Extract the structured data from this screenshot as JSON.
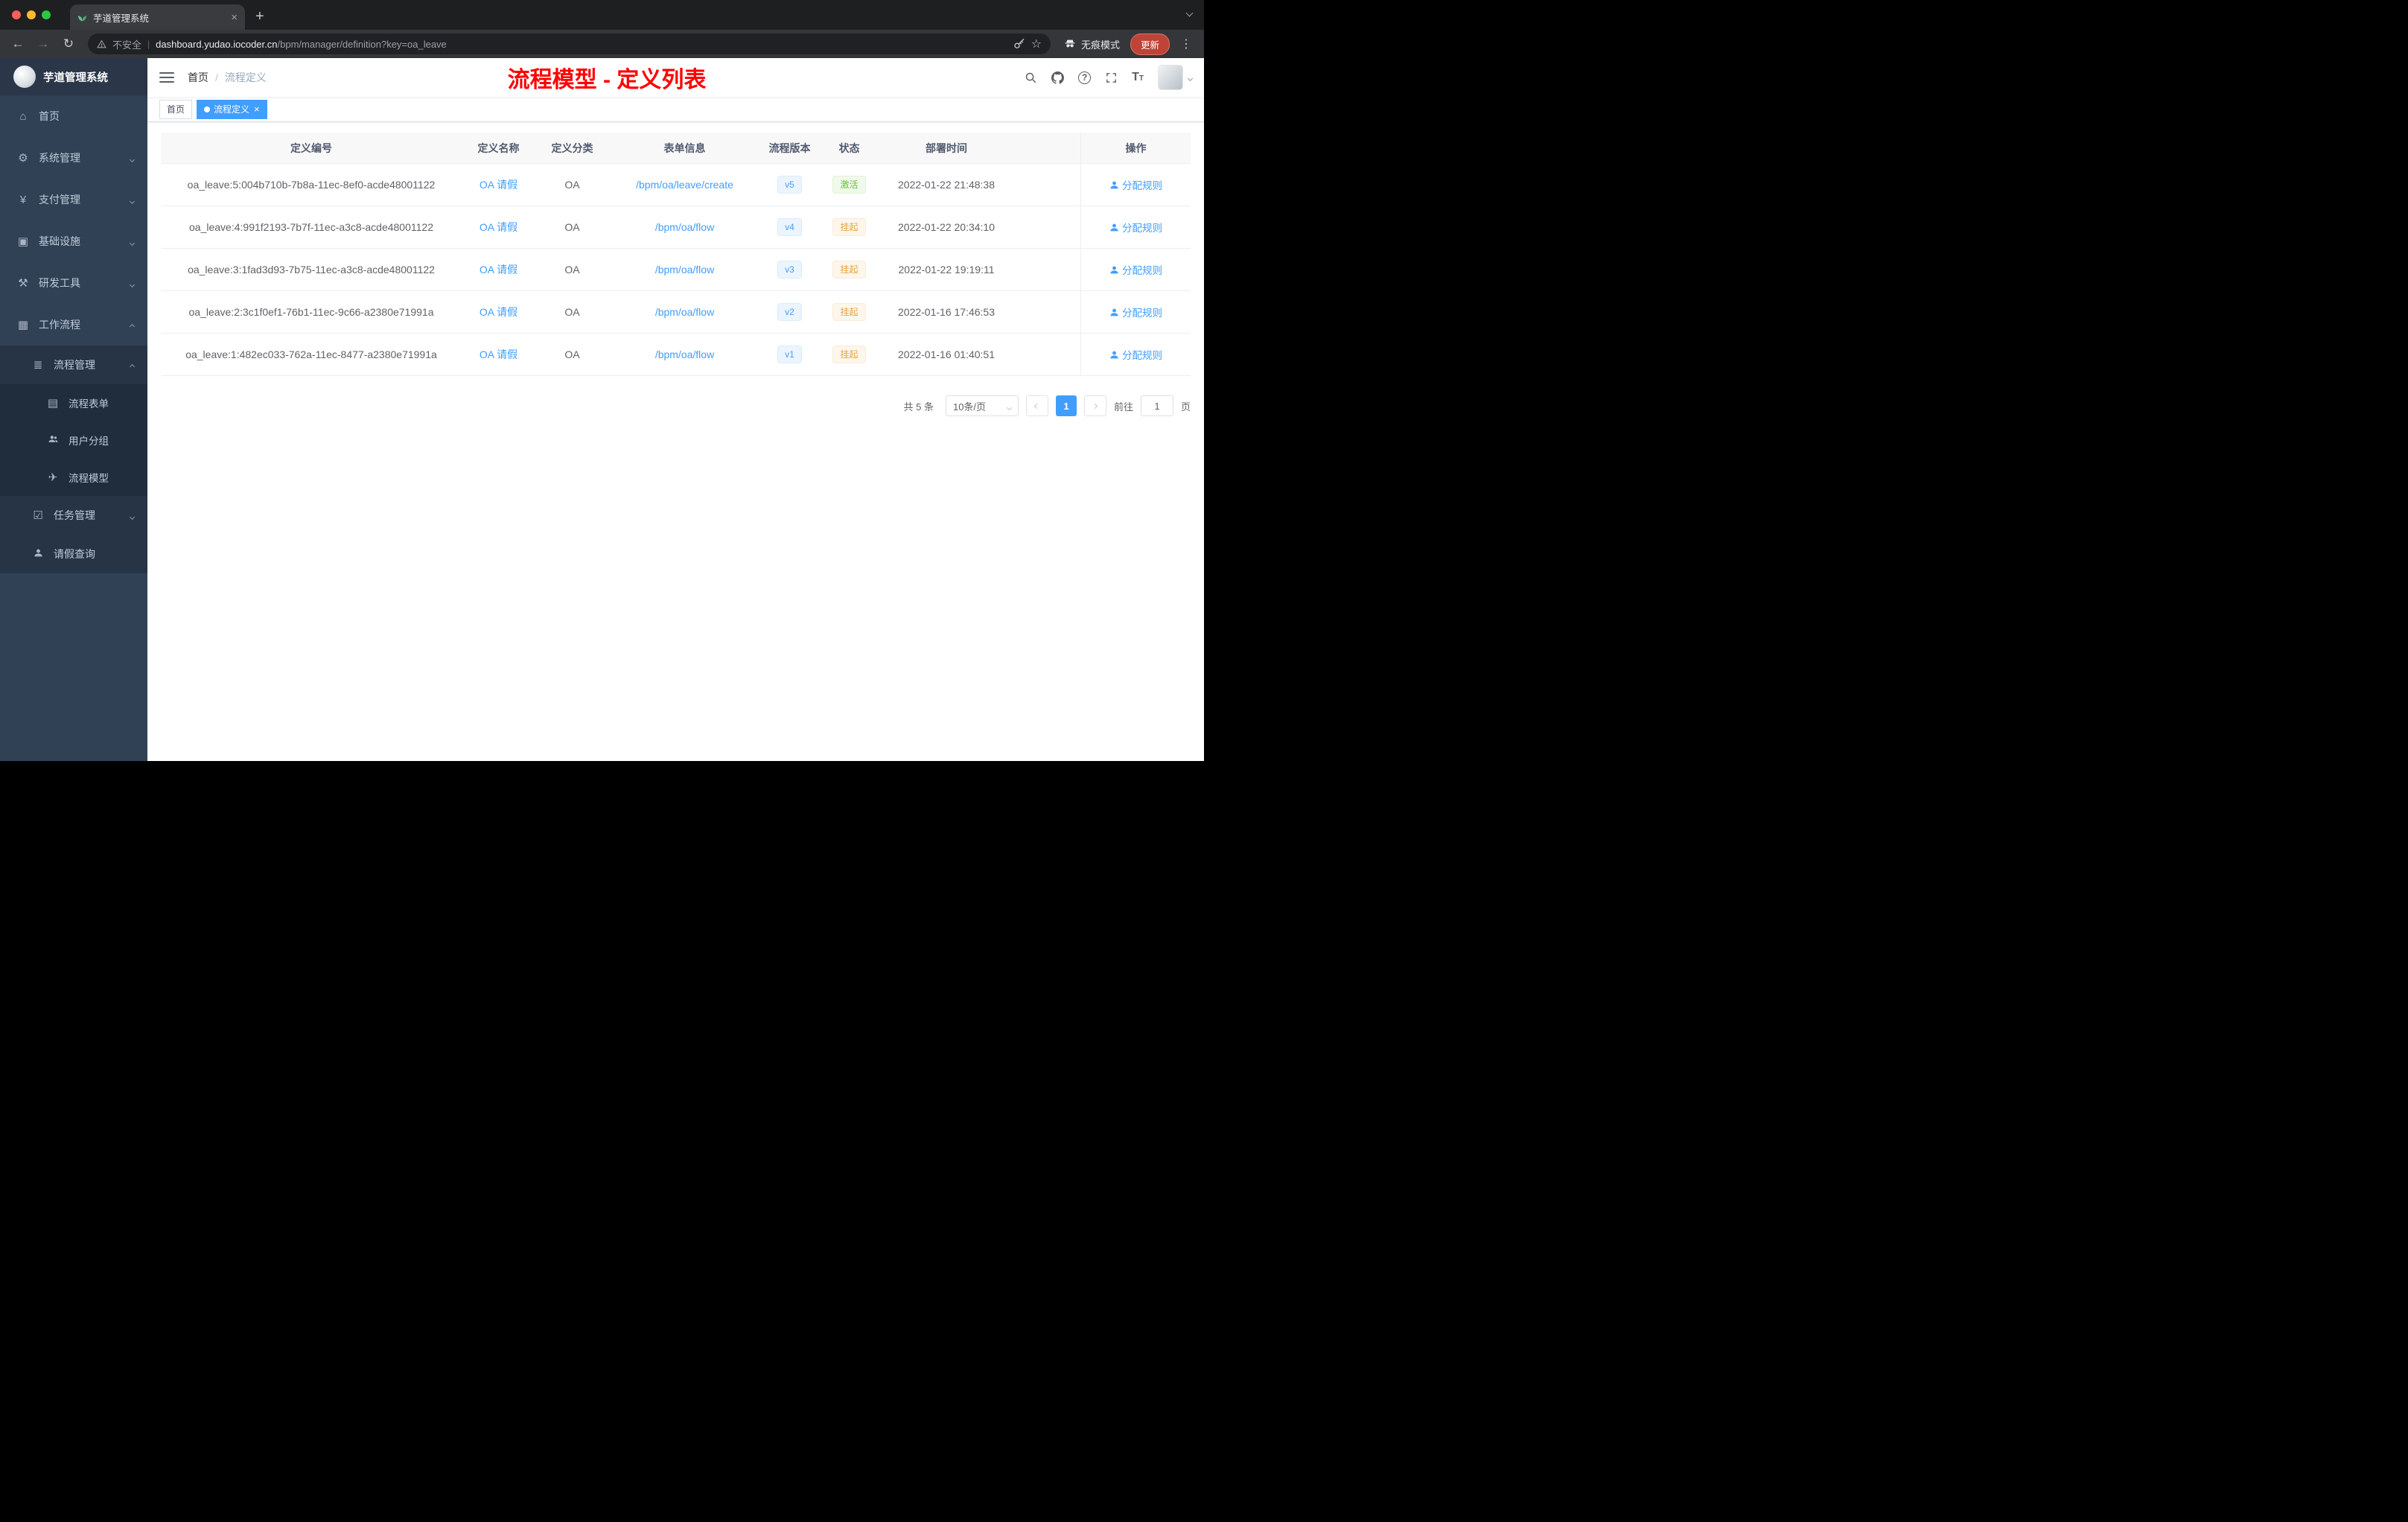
{
  "colors": {
    "primary": "#409EFF",
    "success": "#67C23A",
    "warning": "#E6A23C",
    "annotation_red": "#FF0000",
    "sidebar_bg": "#304156"
  },
  "icons": {
    "back": "←",
    "forward": "→",
    "reload": "↻",
    "new_tab": "+",
    "close": "×",
    "kebab": "⋮",
    "star": "☆",
    "home": "⌂",
    "system": "⚙",
    "payment": "¥",
    "infrastructure": "▣",
    "devtools": "⚒",
    "workflow": "▦",
    "process_mgmt": "≣",
    "form": "▤",
    "model": "✈",
    "task": "☑",
    "question": "?",
    "font_large": "T",
    "font_small": "T"
  },
  "browser": {
    "tab_title": "芋道管理系统",
    "security_text": "不安全",
    "url_host": "dashboard.yudao.iocoder.cn",
    "url_path": "/bpm/manager/definition?key=oa_leave",
    "incognito_label": "无痕模式",
    "update_label": "更新"
  },
  "sidebar": {
    "logo_title": "芋道管理系统",
    "items": [
      {
        "label": "首页"
      },
      {
        "label": "系统管理"
      },
      {
        "label": "支付管理"
      },
      {
        "label": "基础设施"
      },
      {
        "label": "研发工具"
      },
      {
        "label": "工作流程"
      }
    ],
    "workflow": {
      "process_management": "流程管理",
      "process_children": [
        {
          "label": "流程表单"
        },
        {
          "label": "用户分组"
        },
        {
          "label": "流程模型"
        }
      ],
      "task_management": "任务管理",
      "leave_query": "请假查询"
    }
  },
  "navbar": {
    "breadcrumb_home": "首页",
    "breadcrumb_sep": "/",
    "breadcrumb_current": "流程定义",
    "annotation": "流程模型 - 定义列表"
  },
  "tags": {
    "home": "首页",
    "current": "流程定义"
  },
  "table": {
    "headers": [
      "定义编号",
      "定义名称",
      "定义分类",
      "表单信息",
      "流程版本",
      "状态",
      "部署时间",
      "操作"
    ],
    "rows": [
      {
        "id": "oa_leave:5:004b710b-7b8a-11ec-8ef0-acde48001122",
        "name": "OA 请假",
        "category": "OA",
        "form": "/bpm/oa/leave/create",
        "version": "v5",
        "status": "激活",
        "status_type": "success",
        "time": "2022-01-22 21:48:38",
        "action": "分配规则"
      },
      {
        "id": "oa_leave:4:991f2193-7b7f-11ec-a3c8-acde48001122",
        "name": "OA 请假",
        "category": "OA",
        "form": "/bpm/oa/flow",
        "version": "v4",
        "status": "挂起",
        "status_type": "warning",
        "time": "2022-01-22 20:34:10",
        "action": "分配规则"
      },
      {
        "id": "oa_leave:3:1fad3d93-7b75-11ec-a3c8-acde48001122",
        "name": "OA 请假",
        "category": "OA",
        "form": "/bpm/oa/flow",
        "version": "v3",
        "status": "挂起",
        "status_type": "warning",
        "time": "2022-01-22 19:19:11",
        "action": "分配规则"
      },
      {
        "id": "oa_leave:2:3c1f0ef1-76b1-11ec-9c66-a2380e71991a",
        "name": "OA 请假",
        "category": "OA",
        "form": "/bpm/oa/flow",
        "version": "v2",
        "status": "挂起",
        "status_type": "warning",
        "time": "2022-01-16 17:46:53",
        "action": "分配规则"
      },
      {
        "id": "oa_leave:1:482ec033-762a-11ec-8477-a2380e71991a",
        "name": "OA 请假",
        "category": "OA",
        "form": "/bpm/oa/flow",
        "version": "v1",
        "status": "挂起",
        "status_type": "warning",
        "time": "2022-01-16 01:40:51",
        "action": "分配规则"
      }
    ]
  },
  "pagination": {
    "total": "共 5 条",
    "page_size": "10条/页",
    "current_page": "1",
    "goto_label": "前往",
    "goto_value": "1",
    "page_unit": "页"
  }
}
